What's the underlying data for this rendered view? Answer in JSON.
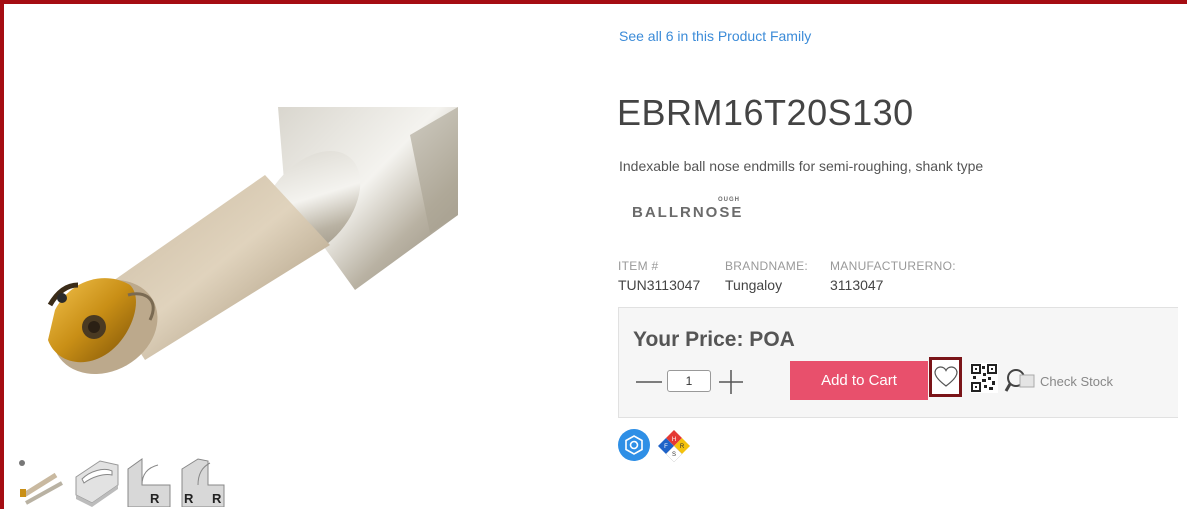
{
  "product": {
    "family_link": "See all 6 in this Product Family",
    "title": "EBRM16T20S130",
    "description": "Indexable ball nose endmills for semi-roughing, shank type",
    "brand_logo_text": "BALLRNOSE",
    "brand_logo_small": "OUGH"
  },
  "attributes": [
    {
      "label": "ITEM #",
      "value": "TUN3113047"
    },
    {
      "label": "BRANDNAME:",
      "value": "Tungaloy"
    },
    {
      "label": "MANUFACTURERNO:",
      "value": "3113047"
    }
  ],
  "pricing": {
    "price_label": "Your Price: POA",
    "quantity": "1",
    "add_to_cart_label": "Add to Cart",
    "check_stock_label": "Check Stock"
  },
  "thumbnails": [
    {
      "name": "product-thumbnail"
    },
    {
      "name": "feature-icon-slot"
    },
    {
      "name": "feature-icon-r"
    },
    {
      "name": "feature-icon-r-r"
    }
  ],
  "thumb_labels": {
    "r": "R",
    "r2": "R"
  },
  "hazard_letters": {
    "top": "H",
    "left": "F",
    "right": "R",
    "bottom": "S"
  },
  "colors": {
    "accent_frame": "#a50d12",
    "link": "#3b8bd8",
    "add_to_cart": "#e8506c",
    "wishlist_border": "#7a1418",
    "badge_blue": "#2e8fe6"
  },
  "icons": [
    "heart-icon",
    "qr-code-icon",
    "magnify-icon",
    "minus-icon",
    "plus-icon",
    "hexagon-badge-icon",
    "hazard-diamond-icon"
  ]
}
